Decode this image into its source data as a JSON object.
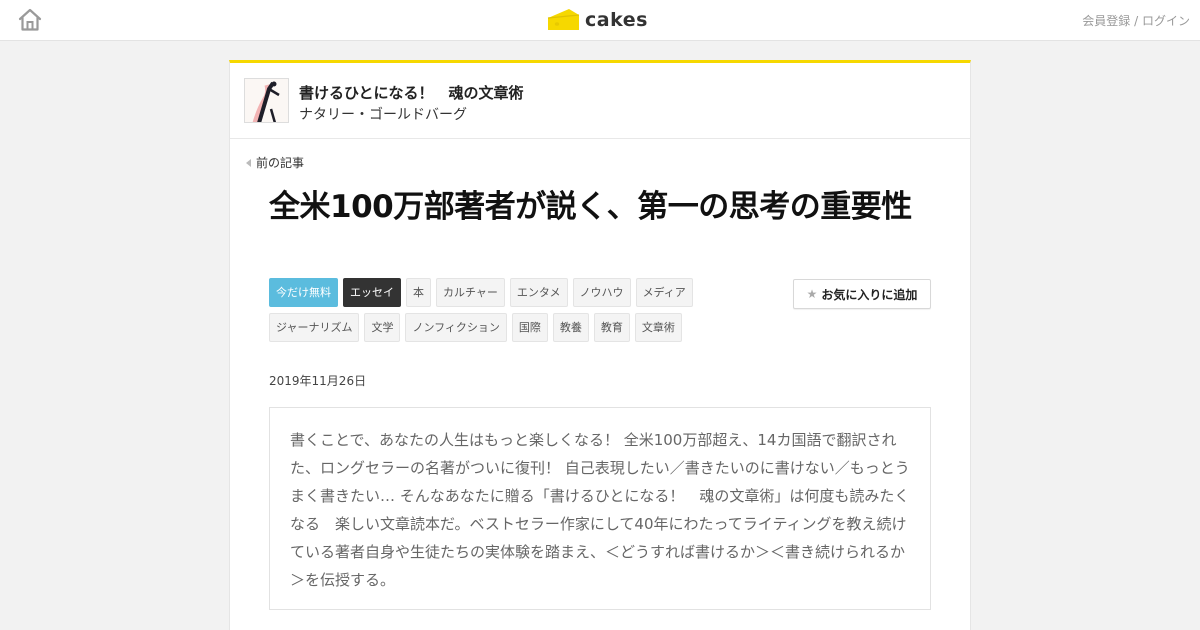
{
  "header": {
    "logo_text": "cakes",
    "auth_register": "会員登録",
    "auth_separator": " / ",
    "auth_login": "ログイン"
  },
  "series": {
    "title": "書けるひとになる！　魂の文章術",
    "author": "ナタリー・ゴールドバーグ"
  },
  "nav": {
    "prev_label": "前の記事"
  },
  "article": {
    "title": "全米100万部著者が説く、第一の思考の重要性",
    "tags": [
      "今だけ無料",
      "エッセイ",
      "本",
      "カルチャー",
      "エンタメ",
      "ノウハウ",
      "メディア",
      "ジャーナリズム",
      "文学",
      "ノンフィクション",
      "国際",
      "教養",
      "教育",
      "文章術"
    ],
    "favorite_label": "お気に入りに追加",
    "date": "2019年11月26日",
    "summary": "書くことで、あなたの人生はもっと楽しくなる！ 全米100万部超え、14カ国語で翻訳された、ロングセラーの名著がついに復刊！ 自己表現したい／書きたいのに書けない／もっとうまく書きたい… そんなあなたに贈る「書けるひとになる！　魂の文章術」は何度も読みたくなる　楽しい文章読本だ。ベストセラー作家にして40年にわたってライティングを教え続けている著者自身や生徒たちの実体験を踏まえ、＜どうすれば書けるか＞＜書き続けられるか＞を伝授する。"
  },
  "colors": {
    "accent_yellow": "#f6d800",
    "free_tag": "#5bbcde",
    "dark_tag": "#333333"
  },
  "icons": {
    "home": "home-icon",
    "logo": "cheese-logo-icon",
    "prev": "caret-left-icon",
    "star": "star-icon"
  }
}
